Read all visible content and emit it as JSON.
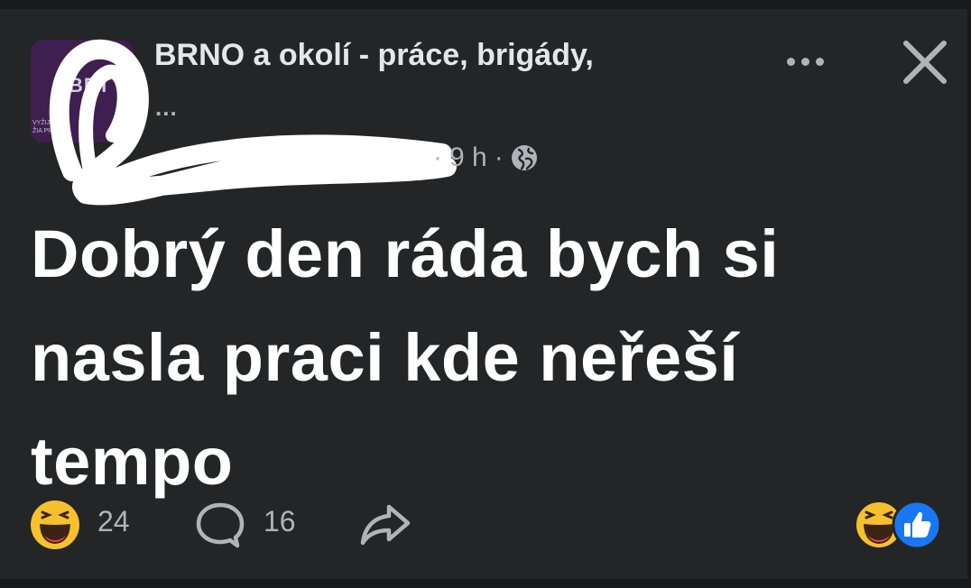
{
  "post": {
    "group_name": "BRNO a okolí - práce, brigády,",
    "group_name_more": "...",
    "avatar_text": "BET",
    "time": "9 h",
    "separator": "·",
    "text": "Dobrý den ráda bych si\nnasla praci kde neřeší\ntempo"
  },
  "icons": {
    "more": "more-horizontal-icon",
    "close": "close-icon",
    "privacy": "globe-icon",
    "reaction": "haha-emoji-icon",
    "comment": "comment-bubble-icon",
    "share": "share-arrow-icon",
    "like": "like-thumb-icon"
  },
  "footer": {
    "reactions_count": "24",
    "comments_count": "16"
  },
  "colors": {
    "background": "#242526",
    "text_primary": "#ffffff",
    "text_secondary": "#b0b3b8",
    "like_blue": "#1877f2",
    "emoji_yellow": "#f7c12e"
  }
}
